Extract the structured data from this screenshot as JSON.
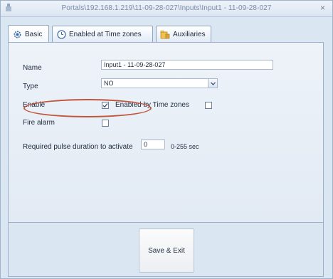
{
  "window": {
    "title": "Portals\\192.168.1.219\\11-09-28-027\\Inputs\\Input1 - 11-09-28-027",
    "close_glyph": "×"
  },
  "tabs": [
    {
      "label": "Basic",
      "icon": "gear-icon",
      "active": true
    },
    {
      "label": "Enabled at Time zones",
      "icon": "clock-icon",
      "active": false
    },
    {
      "label": "Auxiliaries",
      "icon": "folder-ruler-icon",
      "active": false
    }
  ],
  "form": {
    "name_label": "Name",
    "name_value": "Input1 - 11-09-28-027",
    "type_label": "Type",
    "type_value": "NO",
    "enable_label": "Enable",
    "enable_checked": true,
    "enabled_by_tz_label": "Enabled by Time zones",
    "enabled_by_tz_checked": false,
    "fire_alarm_label": "Fire alarm",
    "fire_alarm_checked": false,
    "pulse_label": "Required pulse duration to activate",
    "pulse_value": "0",
    "pulse_hint": "0-255 sec"
  },
  "footer": {
    "save_label": "Save & Exit"
  },
  "colors": {
    "window_bg": "#dbe6f3",
    "highlight_ring": "#c0563c",
    "title_text": "#7b8ca6"
  }
}
